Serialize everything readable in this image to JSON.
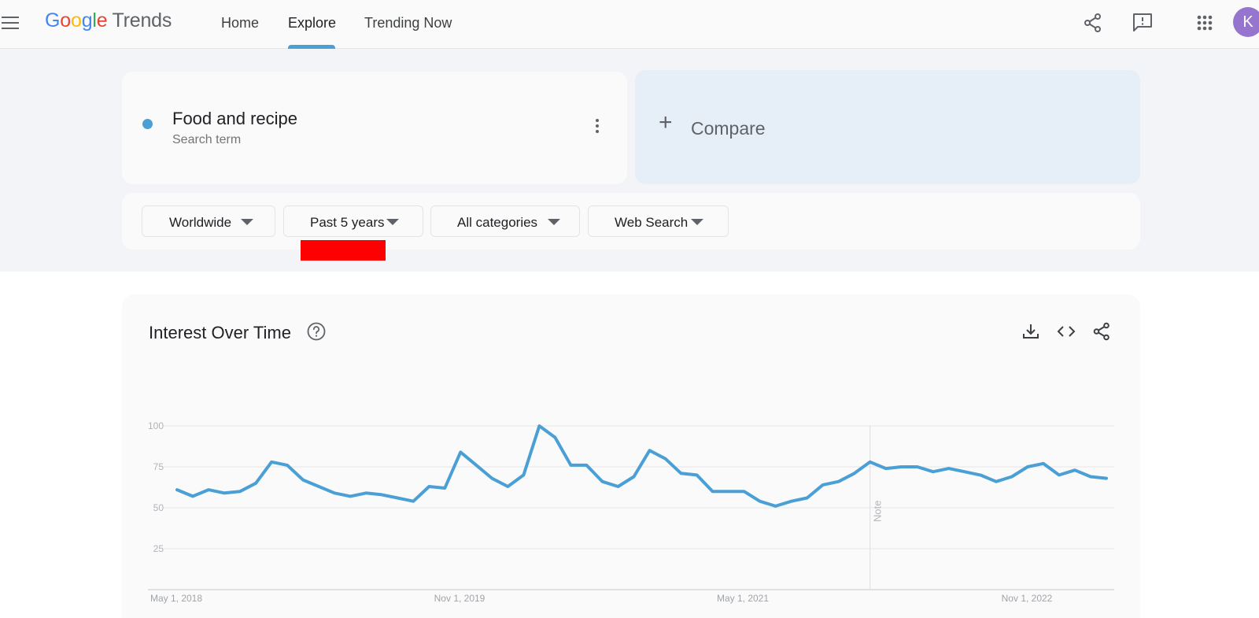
{
  "header": {
    "logo": {
      "google": [
        "G",
        "o",
        "o",
        "g",
        "l",
        "e"
      ],
      "trends": "Trends"
    },
    "nav": [
      {
        "label": "Home"
      },
      {
        "label": "Explore",
        "active": true
      },
      {
        "label": "Trending Now"
      }
    ],
    "icons": [
      "menu-icon",
      "share-icon",
      "feedback-icon",
      "apps-icon"
    ],
    "avatar_letter": "K",
    "avatar_color": "#9575cd"
  },
  "search": {
    "term": {
      "name": "Food and recipe",
      "type": "Search term",
      "color": "#4a9fd5"
    },
    "compare_label": "Compare",
    "filters": [
      {
        "label": "Worldwide"
      },
      {
        "label": "Past 5 years"
      },
      {
        "label": "All categories"
      },
      {
        "label": "Web Search"
      }
    ]
  },
  "chart": {
    "title": "Interest Over Time",
    "note_label": "Note",
    "icons": [
      "help-icon",
      "download-icon",
      "embed-icon",
      "share-icon"
    ]
  },
  "chart_data": {
    "type": "line",
    "series": [
      {
        "name": "Food and recipe",
        "color": "#4a9fd5",
        "values": [
          61,
          57,
          61,
          59,
          60,
          65,
          78,
          76,
          67,
          63,
          59,
          57,
          59,
          58,
          56,
          54,
          63,
          62,
          84,
          76,
          68,
          63,
          70,
          100,
          93,
          76,
          76,
          66,
          63,
          69,
          85,
          80,
          71,
          70,
          60,
          60,
          60,
          54,
          51,
          54,
          56,
          64,
          66,
          71,
          78,
          74,
          75,
          75,
          72,
          74,
          72,
          70,
          66,
          69,
          75,
          77,
          70,
          73,
          69,
          68
        ]
      }
    ],
    "ylim": [
      0,
      100
    ],
    "y_ticks": [
      "100",
      "75",
      "50",
      "25"
    ],
    "x_ticks": [
      "May 1, 2018",
      "Nov 1, 2019",
      "May 1, 2021",
      "Nov 1, 2022"
    ],
    "grid": true,
    "note_index": 44
  }
}
